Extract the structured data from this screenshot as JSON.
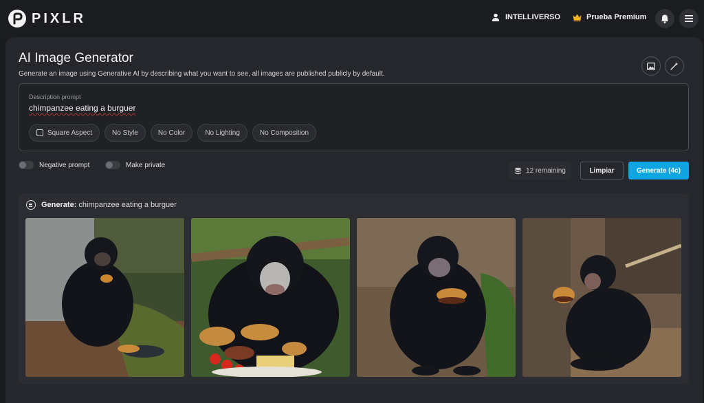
{
  "app": {
    "logo_text": "PIXLR"
  },
  "header": {
    "user_name": "INTELLIVERSO",
    "premium_label": "Prueba Premium",
    "icons": [
      "user-icon",
      "crown-icon",
      "bell-icon",
      "hamburger-menu-icon"
    ]
  },
  "page": {
    "title": "AI Image Generator",
    "subtitle": "Generate an image using Generative AI by describing what you want to see, all images are published publicly by default."
  },
  "prompt": {
    "label": "Description prompt",
    "value": "chimpanzee eating a burguer"
  },
  "chips": [
    "Square Aspect",
    "No Style",
    "No Color",
    "No Lighting",
    "No Composition"
  ],
  "options": {
    "negative_prompt": "Negative prompt",
    "make_private": "Make private"
  },
  "actions": {
    "remaining": "12 remaining",
    "clear_label": "Limpiar",
    "generate_label": "Generate (4c)"
  },
  "results": {
    "heading_label": "Generate:",
    "heading_value": "chimpanzee eating a burguer",
    "images": [
      "chimpanzee sitting holding a burger with a plate",
      "chimpanzee eating with burgers and tomatoes",
      "chimpanzee sitting holding a burger",
      "chimpanzee near a tree eating a burger"
    ]
  },
  "colors": {
    "accent": "#0ea5e0",
    "background": "#1a1b1f",
    "panel": "#26272c"
  }
}
